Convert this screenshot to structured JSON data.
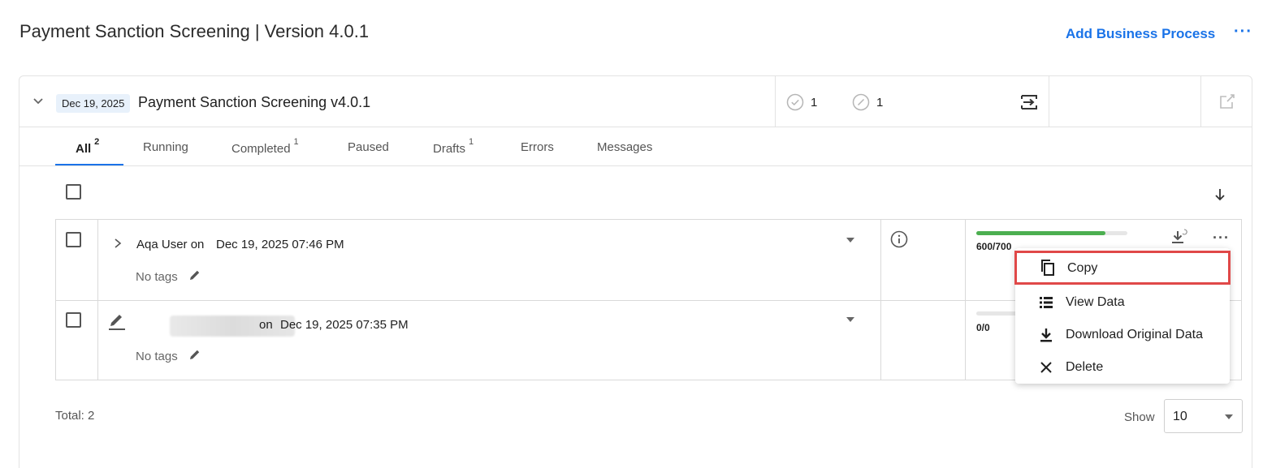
{
  "header": {
    "title": "Payment Sanction Screening | Version 4.0.1",
    "add_business_process": "Add Business Process",
    "more": "···"
  },
  "process": {
    "date_chip": "Dec 19, 2025",
    "name": "Payment Sanction Screening v4.0.1",
    "completed_count": "1",
    "draft_count": "1"
  },
  "tabs": [
    {
      "label": "All",
      "count": "2"
    },
    {
      "label": "Running",
      "count": ""
    },
    {
      "label": "Completed",
      "count": "1"
    },
    {
      "label": "Paused",
      "count": ""
    },
    {
      "label": "Drafts",
      "count": "1"
    },
    {
      "label": "Errors",
      "count": ""
    },
    {
      "label": "Messages",
      "count": ""
    }
  ],
  "rows": [
    {
      "author": "Aqa User on",
      "datetime": "Dec 19, 2025 07:46 PM",
      "tags": "No tags",
      "progress_text": "600/700",
      "progress_fraction": 0.857
    },
    {
      "author": "on",
      "datetime": "Dec 19, 2025 07:35 PM",
      "tags": "No tags",
      "progress_text": "0/0",
      "progress_fraction": 0
    }
  ],
  "footer": {
    "total": "Total: 2",
    "show_label": "Show",
    "page_size": "10"
  },
  "context_menu": {
    "items": [
      {
        "label": "Copy",
        "icon": "copy-icon"
      },
      {
        "label": "View Data",
        "icon": "list-icon"
      },
      {
        "label": "Download Original Data",
        "icon": "download-icon"
      },
      {
        "label": "Delete",
        "icon": "close-icon"
      }
    ],
    "selected": "Copy"
  },
  "colors": {
    "accent": "#1a73e8",
    "progress": "#4caf50",
    "highlight": "#e04848"
  }
}
